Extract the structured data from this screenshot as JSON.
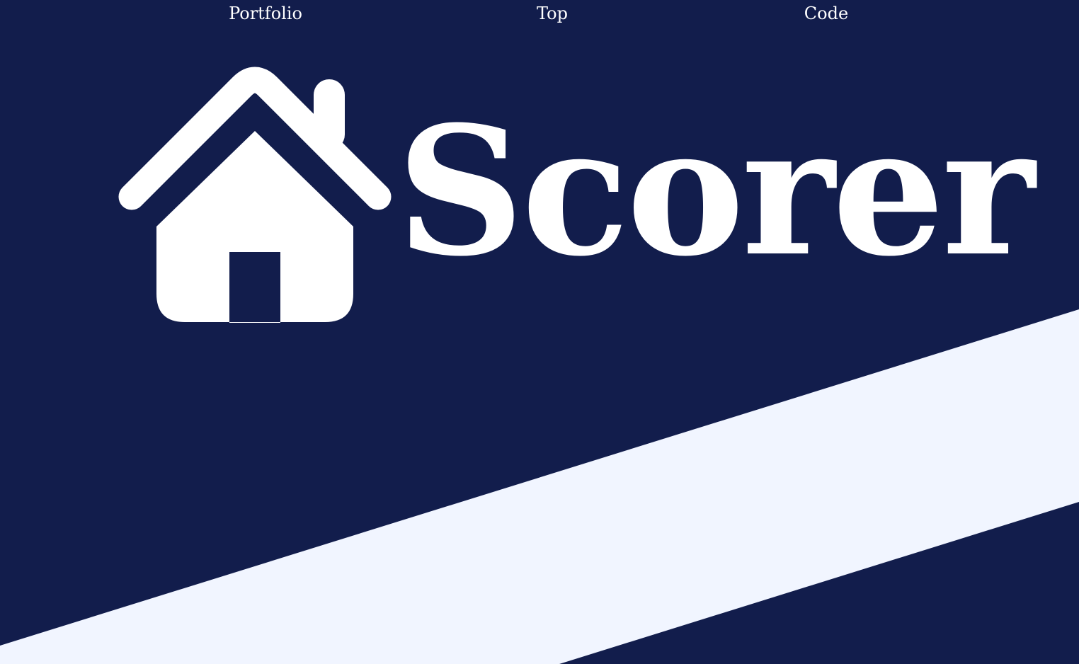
{
  "nav": {
    "portfolio_label": "Portfolio",
    "top_label": "Top",
    "code_label": "Code"
  },
  "hero": {
    "title": "Scorer",
    "logo_icon": "house-icon"
  },
  "colors": {
    "background": "#121d4c",
    "foreground": "#ffffff",
    "stripe": "#f1f5ff"
  }
}
